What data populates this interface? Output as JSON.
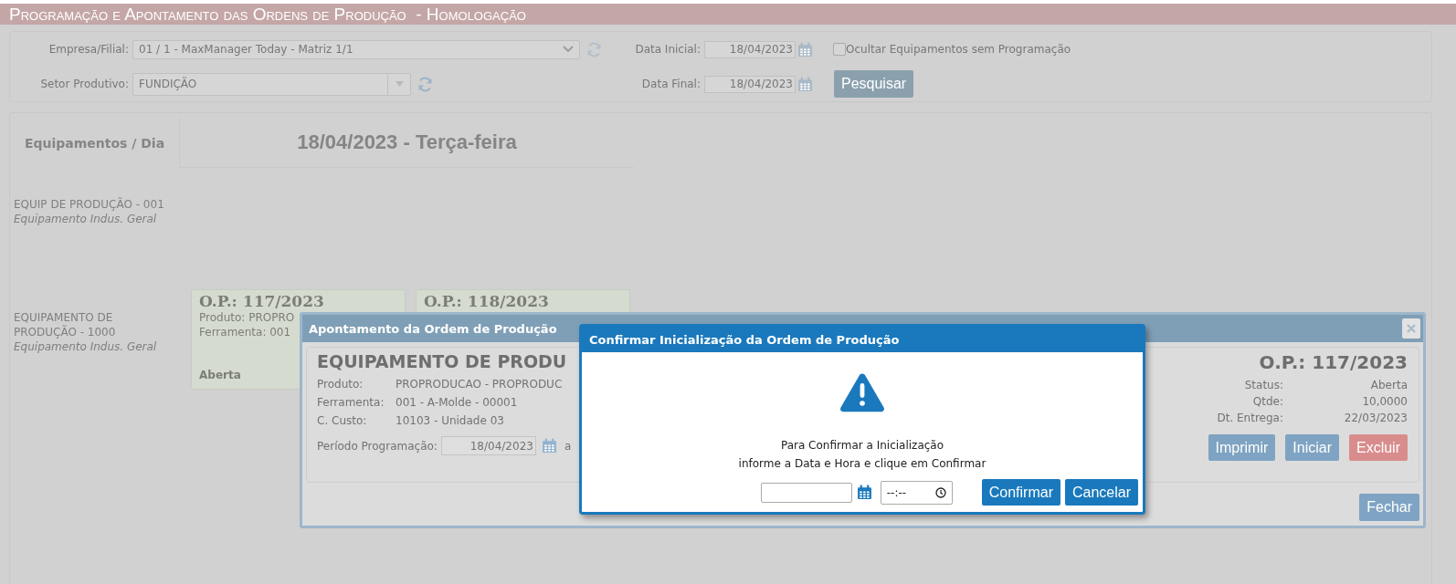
{
  "title_bar": {
    "title": "Programação e Apontamento das Ordens de Produção  - Homologação"
  },
  "filters": {
    "company": {
      "label": "Empresa/Filial:",
      "value": "01 / 1 - MaxManager Today - Matriz 1/1"
    },
    "sector": {
      "label": "Setor Produtivo:",
      "value": "FUNDIÇÃO"
    },
    "start_date": {
      "label": "Data Inicial:",
      "value": "18/04/2023"
    },
    "end_date": {
      "label": "Data Final:",
      "value": "18/04/2023"
    },
    "hide_unscheduled": {
      "label": "Ocultar Equipamentos sem Programação",
      "checked": false
    },
    "search_button": "Pesquisar"
  },
  "schedule": {
    "corner_header": "Equipamentos / Dia",
    "day_header": "18/04/2023 - Terça-feira",
    "equipment": [
      {
        "name": "EQUIP DE PRODUÇÃO - 001",
        "type": "Equipamento Indus. Geral"
      },
      {
        "name": "EQUIPAMENTO DE PRODUÇÃO - 1000",
        "type": "Equipamento Indus. Geral",
        "orders": [
          {
            "number": "O.P.: 117/2023",
            "lines": [
              "Produto: PROPRO",
              "Ferramenta: 001"
            ],
            "status": "Aberta"
          },
          {
            "number": "O.P.: 118/2023"
          }
        ]
      }
    ]
  },
  "order_dialog": {
    "title": "Apontamento da Ordem de Produção",
    "equipment": "EQUIPAMENTO DE PRODU",
    "details": [
      {
        "label": "Produto:",
        "value": "PROPRODUCAO - PROPRODUC"
      },
      {
        "label": "Ferramenta:",
        "value": "001 - A-Molde - 00001"
      },
      {
        "label": "C. Custo:",
        "value": "10103 - Unidade 03"
      }
    ],
    "period": {
      "label": "Período Programação:",
      "start": "18/04/2023",
      "separator": "a"
    },
    "order_number": "O.P.: 117/2023",
    "summary": [
      {
        "label": "Status:",
        "value": "Aberta"
      },
      {
        "label": "Qtde:",
        "value": "10,0000"
      },
      {
        "label": "Dt. Entrega:",
        "value": "22/03/2023"
      }
    ],
    "actions": [
      {
        "label": "Imprimir",
        "kind": "primary"
      },
      {
        "label": "Iniciar",
        "kind": "primary"
      },
      {
        "label": "Excluir",
        "kind": "danger"
      }
    ],
    "close_button": "Fechar"
  },
  "confirm_dialog": {
    "title": "Confirmar Inicialização da Ordem de Produção",
    "message_lines": [
      "Para Confirmar a Inicialização",
      "informe a Data e Hora e clique em Confirmar"
    ],
    "time_field": {
      "placeholder": "--:--"
    },
    "buttons": [
      {
        "label": "Confirmar"
      },
      {
        "label": "Cancelar"
      }
    ]
  }
}
